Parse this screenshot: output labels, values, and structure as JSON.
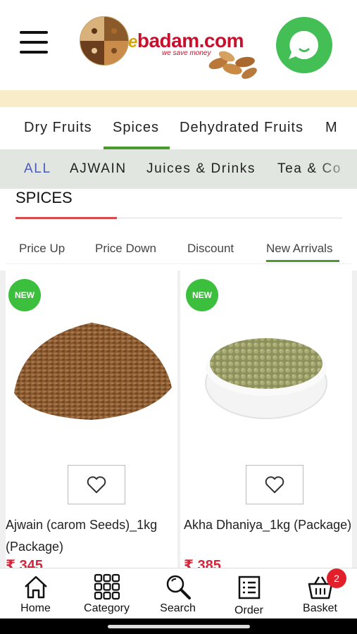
{
  "header": {
    "logo": {
      "brand_prefix": "e",
      "brand_rest": "badam.com",
      "tagline": "we save money"
    }
  },
  "category_tabs": [
    "Dry Fruits",
    "Spices",
    "Dehydrated Fruits",
    "M"
  ],
  "active_category": "Spices",
  "sub_tabs": [
    "ALL",
    "AJWAIN",
    "Juices & Drinks",
    "Tea & Co"
  ],
  "active_sub_tab": "ALL",
  "section_title": "SPICES",
  "sort_tabs": [
    "Price Up",
    "Price Down",
    "Discount",
    "New Arrivals"
  ],
  "active_sort": "New Arrivals",
  "products": [
    {
      "badge": "NEW",
      "name": "Ajwain (carom Seeds)_1kg (Package)",
      "price": "₹ 345"
    },
    {
      "badge": "NEW",
      "name": "Akha Dhaniya_1kg (Package)",
      "price": "₹ 385"
    }
  ],
  "bottom_nav": [
    {
      "label": "Home",
      "icon": "home-icon"
    },
    {
      "label": "Category",
      "icon": "grid-icon"
    },
    {
      "label": "Search",
      "icon": "search-icon"
    },
    {
      "label": "Order",
      "icon": "order-icon"
    },
    {
      "label": "Basket",
      "icon": "basket-icon",
      "badge": "2"
    }
  ],
  "colors": {
    "accent_green": "#43bf55",
    "brand_red": "#c8102e",
    "active_sub_tab": "#4b5ab8",
    "price_red": "#d3263a"
  }
}
